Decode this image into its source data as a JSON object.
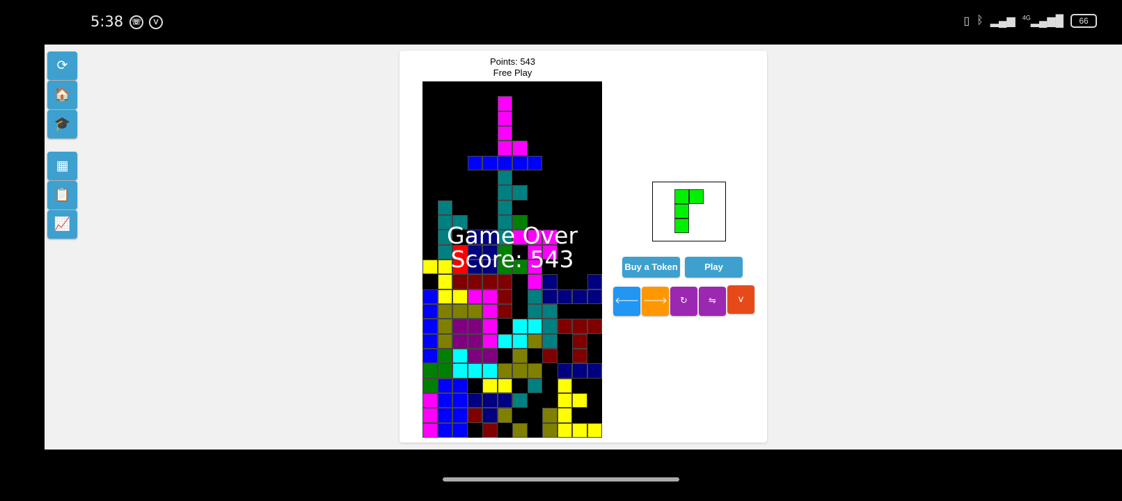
{
  "status_bar": {
    "time": "5:38",
    "left_icons": [
      "whatsapp-icon",
      "vpn-icon"
    ],
    "right_icons": [
      "vibrate-icon",
      "bluetooth-icon",
      "signal-icon",
      "4g-signal-icon"
    ],
    "network_label": "4G",
    "battery": "66"
  },
  "sidebar": {
    "buttons": [
      {
        "name": "refresh-button",
        "icon": "refresh-icon",
        "glyph": "⟳"
      },
      {
        "name": "home-button",
        "icon": "home-icon",
        "glyph": "🏠"
      },
      {
        "name": "tutorial-button",
        "icon": "graduation-cap-icon",
        "glyph": "🎓"
      },
      {
        "name": "grid-button",
        "icon": "grid-icon",
        "glyph": "▦"
      },
      {
        "name": "clipboard-button",
        "icon": "clipboard-icon",
        "glyph": "📋"
      },
      {
        "name": "stats-button",
        "icon": "chart-icon",
        "glyph": "📈"
      }
    ]
  },
  "game": {
    "points_label": "Points: 543",
    "mode_label": "Free Play",
    "overlay_line1": "Game Over",
    "overlay_line2": "Score: 543",
    "buy_token_label": "Buy a Token",
    "play_label": "Play",
    "controls": [
      {
        "name": "move-left-button",
        "icon": "arrow-left-icon",
        "glyph": "🡐",
        "color": "#2196f3"
      },
      {
        "name": "move-right-button",
        "icon": "arrow-right-icon",
        "glyph": "🡒",
        "color": "#ff9800"
      },
      {
        "name": "rotate-button",
        "icon": "rotate-icon",
        "glyph": "↻",
        "color": "#9c27b0"
      },
      {
        "name": "swap-button",
        "icon": "swap-icon",
        "glyph": "⇋",
        "color": "#9c27b0"
      },
      {
        "name": "drop-button",
        "icon": "chevron-down-icon",
        "glyph": "v",
        "color": "#e64a19"
      }
    ]
  },
  "board": {
    "cols": 12,
    "rows": 24,
    "colors": {
      "M": "#ff00ff",
      "B": "#0000ff",
      "T": "#008080",
      "G": "#008000",
      "Y": "#ffff00",
      "R": "#ff0000",
      "D": "#800000",
      "N": "#000080",
      "O": "#808000",
      "P": "#800080",
      "C": "#00ffff"
    },
    "grid": [
      "............",
      ".....M......",
      ".....M......",
      ".....M......",
      ".....MM.....",
      "...BBBBB....",
      ".....T......",
      ".....TT.....",
      ".T...T......",
      ".TT..TG.....",
      ".T.NNTMMM...",
      ".TRNNG.MM...",
      "YYRNNGGM....",
      ".YDDDD.MN..N",
      "BYYMMD.TNNNN",
      "BOOOMD.TT...",
      "BOPPM.CCTDDD",
      "BOPPMCCOT.D.",
      "BGCPP.O.D.D.",
      "GGCCCOOO.NNN",
      "GBB.YY.T.Y..",
      "MBBNNNT..YY.",
      "MBBDNO..OY..",
      "MBB.D.O.OYYY"
    ],
    "preview": {
      "color": "#00f000",
      "shape": [
        "XX",
        "X.",
        "X.",
        ".."
      ]
    }
  }
}
